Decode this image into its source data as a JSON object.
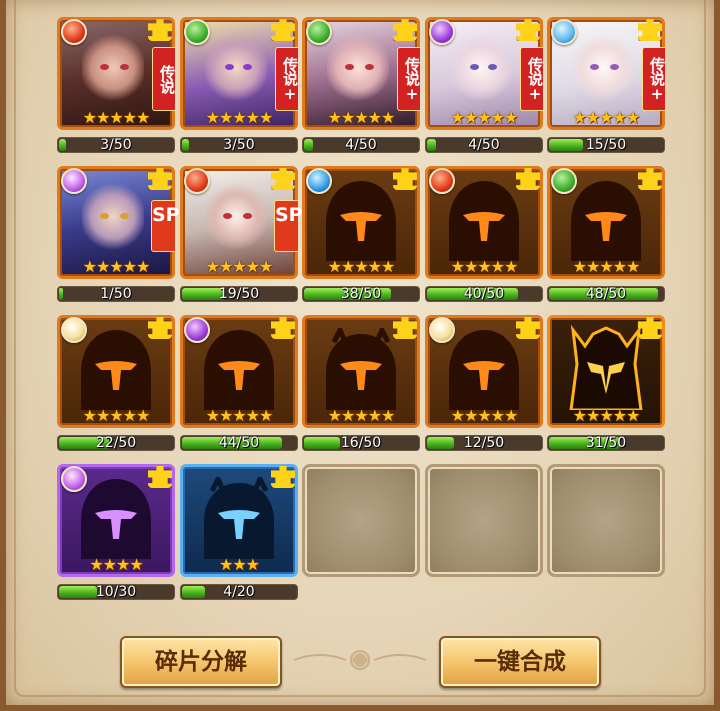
{
  "cards": [
    {
      "element": "fire",
      "tag": "传说",
      "stars": 5,
      "progress": "3/50",
      "fill": 0.06
    },
    {
      "element": "wind",
      "tag": "传说+",
      "stars": 5,
      "progress": "3/50",
      "fill": 0.06
    },
    {
      "element": "wind",
      "tag": "传说+",
      "stars": 5,
      "progress": "4/50",
      "fill": 0.08
    },
    {
      "element": "dark",
      "tag": "传说+",
      "stars": 5,
      "progress": "4/50",
      "fill": 0.08
    },
    {
      "element": "storm",
      "tag": "传说+",
      "stars": 5,
      "progress": "15/50",
      "fill": 0.3
    },
    {
      "element": "dark2",
      "tag": "SP",
      "stars": 5,
      "progress": "1/50",
      "fill": 0.02
    },
    {
      "element": "fire",
      "tag": "SP",
      "stars": 5,
      "progress": "19/50",
      "fill": 0.38
    },
    {
      "element": "water",
      "tag": "",
      "stars": 5,
      "progress": "38/50",
      "fill": 0.76
    },
    {
      "element": "fire",
      "tag": "",
      "stars": 5,
      "progress": "40/50",
      "fill": 0.8
    },
    {
      "element": "wind",
      "tag": "",
      "stars": 5,
      "progress": "48/50",
      "fill": 0.96
    },
    {
      "element": "light",
      "tag": "",
      "stars": 5,
      "progress": "22/50",
      "fill": 0.44
    },
    {
      "element": "dark",
      "tag": "",
      "stars": 5,
      "progress": "44/50",
      "fill": 0.88
    },
    {
      "element": "",
      "tag": "",
      "stars": 5,
      "progress": "16/50",
      "fill": 0.32
    },
    {
      "element": "light",
      "tag": "",
      "stars": 5,
      "progress": "12/50",
      "fill": 0.24
    },
    {
      "element": "",
      "tag": "",
      "stars": 5,
      "progress": "31/50",
      "fill": 0.62
    },
    {
      "element": "dark2",
      "tag": "",
      "stars": 4,
      "progress": "10/30",
      "fill": 0.33
    },
    {
      "element": "",
      "tag": "",
      "stars": 3,
      "progress": "4/20",
      "fill": 0.2
    }
  ],
  "buttons": {
    "decompose": "碎片分解",
    "synthesize": "一键合成"
  },
  "colors": {
    "progress_fill": "#4cb41e",
    "star": "#ffc21a",
    "rarity_tag": "#d32222"
  }
}
